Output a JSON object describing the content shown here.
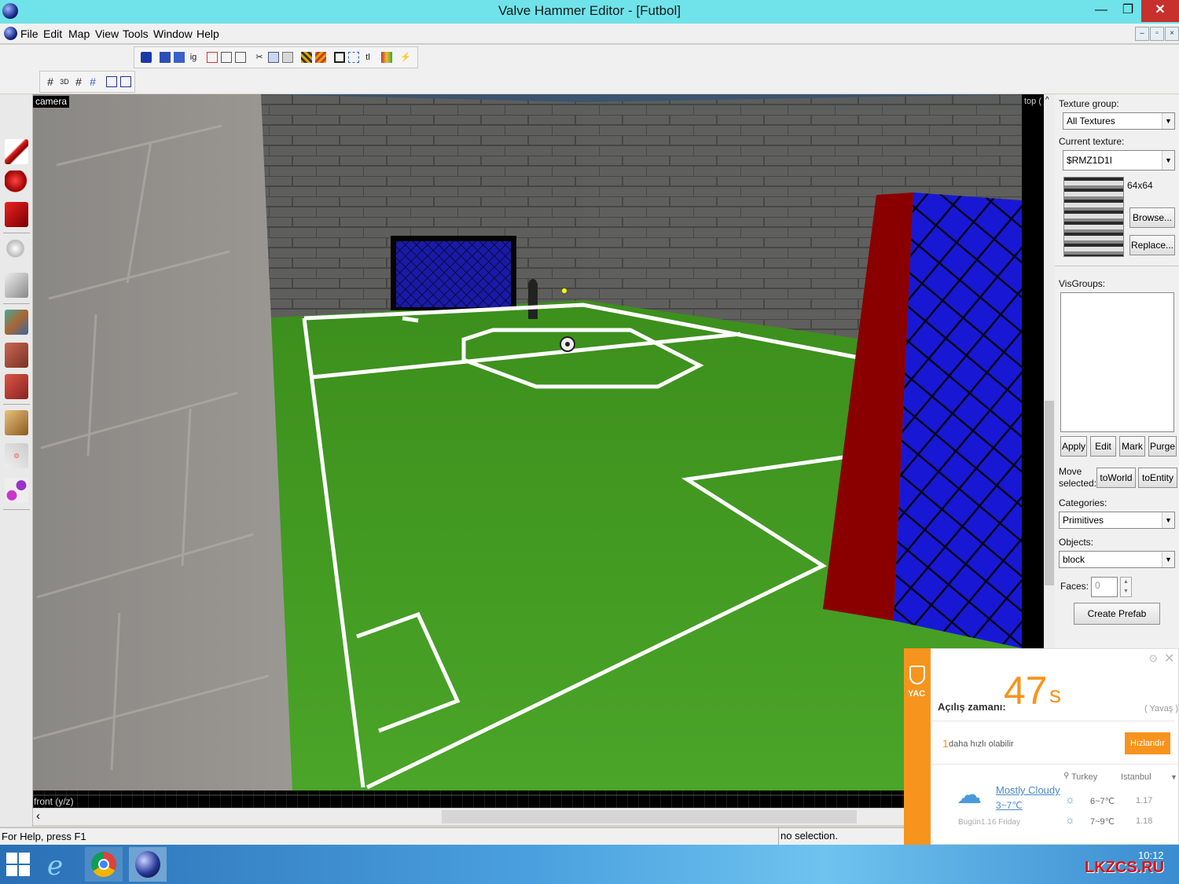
{
  "window": {
    "title": "Valve Hammer Editor - [Futbol]",
    "minimize": "—",
    "maximize": "❐",
    "close": "✕"
  },
  "menu": [
    "File",
    "Edit",
    "Map",
    "View",
    "Tools",
    "Window",
    "Help"
  ],
  "mdi_buttons": [
    "–",
    "▫",
    "×"
  ],
  "toolbar_glyphs": {
    "ig": "ig",
    "tl": "tl",
    "grid3d": "3D"
  },
  "viewport": {
    "camera_label": "camera",
    "front_label": "front (y/z)",
    "top_label": "top (",
    "scroll_left": "‹"
  },
  "panel": {
    "texture_group_label": "Texture group:",
    "texture_group_value": "All Textures",
    "current_texture_label": "Current texture:",
    "current_texture_value": "$RMZ1D1I",
    "texture_size": "64x64",
    "browse": "Browse...",
    "replace": "Replace...",
    "visgroups_label": "VisGroups:",
    "vis_buttons": [
      "Apply",
      "Edit",
      "Mark",
      "Purge"
    ],
    "move_selected": "Move selected:",
    "to_world": "toWorld",
    "to_entity": "toEntity",
    "categories_label": "Categories:",
    "categories_value": "Primitives",
    "objects_label": "Objects:",
    "objects_value": "block",
    "faces_label": "Faces:",
    "faces_value": "0",
    "create_prefab": "Create Prefab"
  },
  "status": {
    "help": "For Help, press F1",
    "selection": "no selection."
  },
  "yac": {
    "logo": "YAC",
    "boot_label": "Açılış zamanı:",
    "boot_value": "47",
    "boot_unit": "s",
    "speed": "( Yavaş )",
    "tip_count": "1",
    "tip_text": "daha hızlı olabilir",
    "speedup_button": "Hızlandır",
    "weather_text": "Mostly Cloudy",
    "weather_temp": "3~7℃",
    "date_text": "Bugün1.16 Friday",
    "country": "Turkey",
    "city": "Istanbul",
    "forecast": [
      {
        "temp": "6~7℃",
        "date": "1.17"
      },
      {
        "temp": "7~9℃",
        "date": "1.18"
      }
    ]
  },
  "taskbar": {
    "clock": "10:12",
    "watermark": "LKZCS.RU"
  },
  "colors": {
    "titlebar": "#6fe3e9",
    "close": "#c7302c",
    "yac_orange": "#f7941d",
    "grass": "#3f9a1e",
    "goal_blue": "#1a1ad8",
    "goal_red": "#8a0000"
  }
}
